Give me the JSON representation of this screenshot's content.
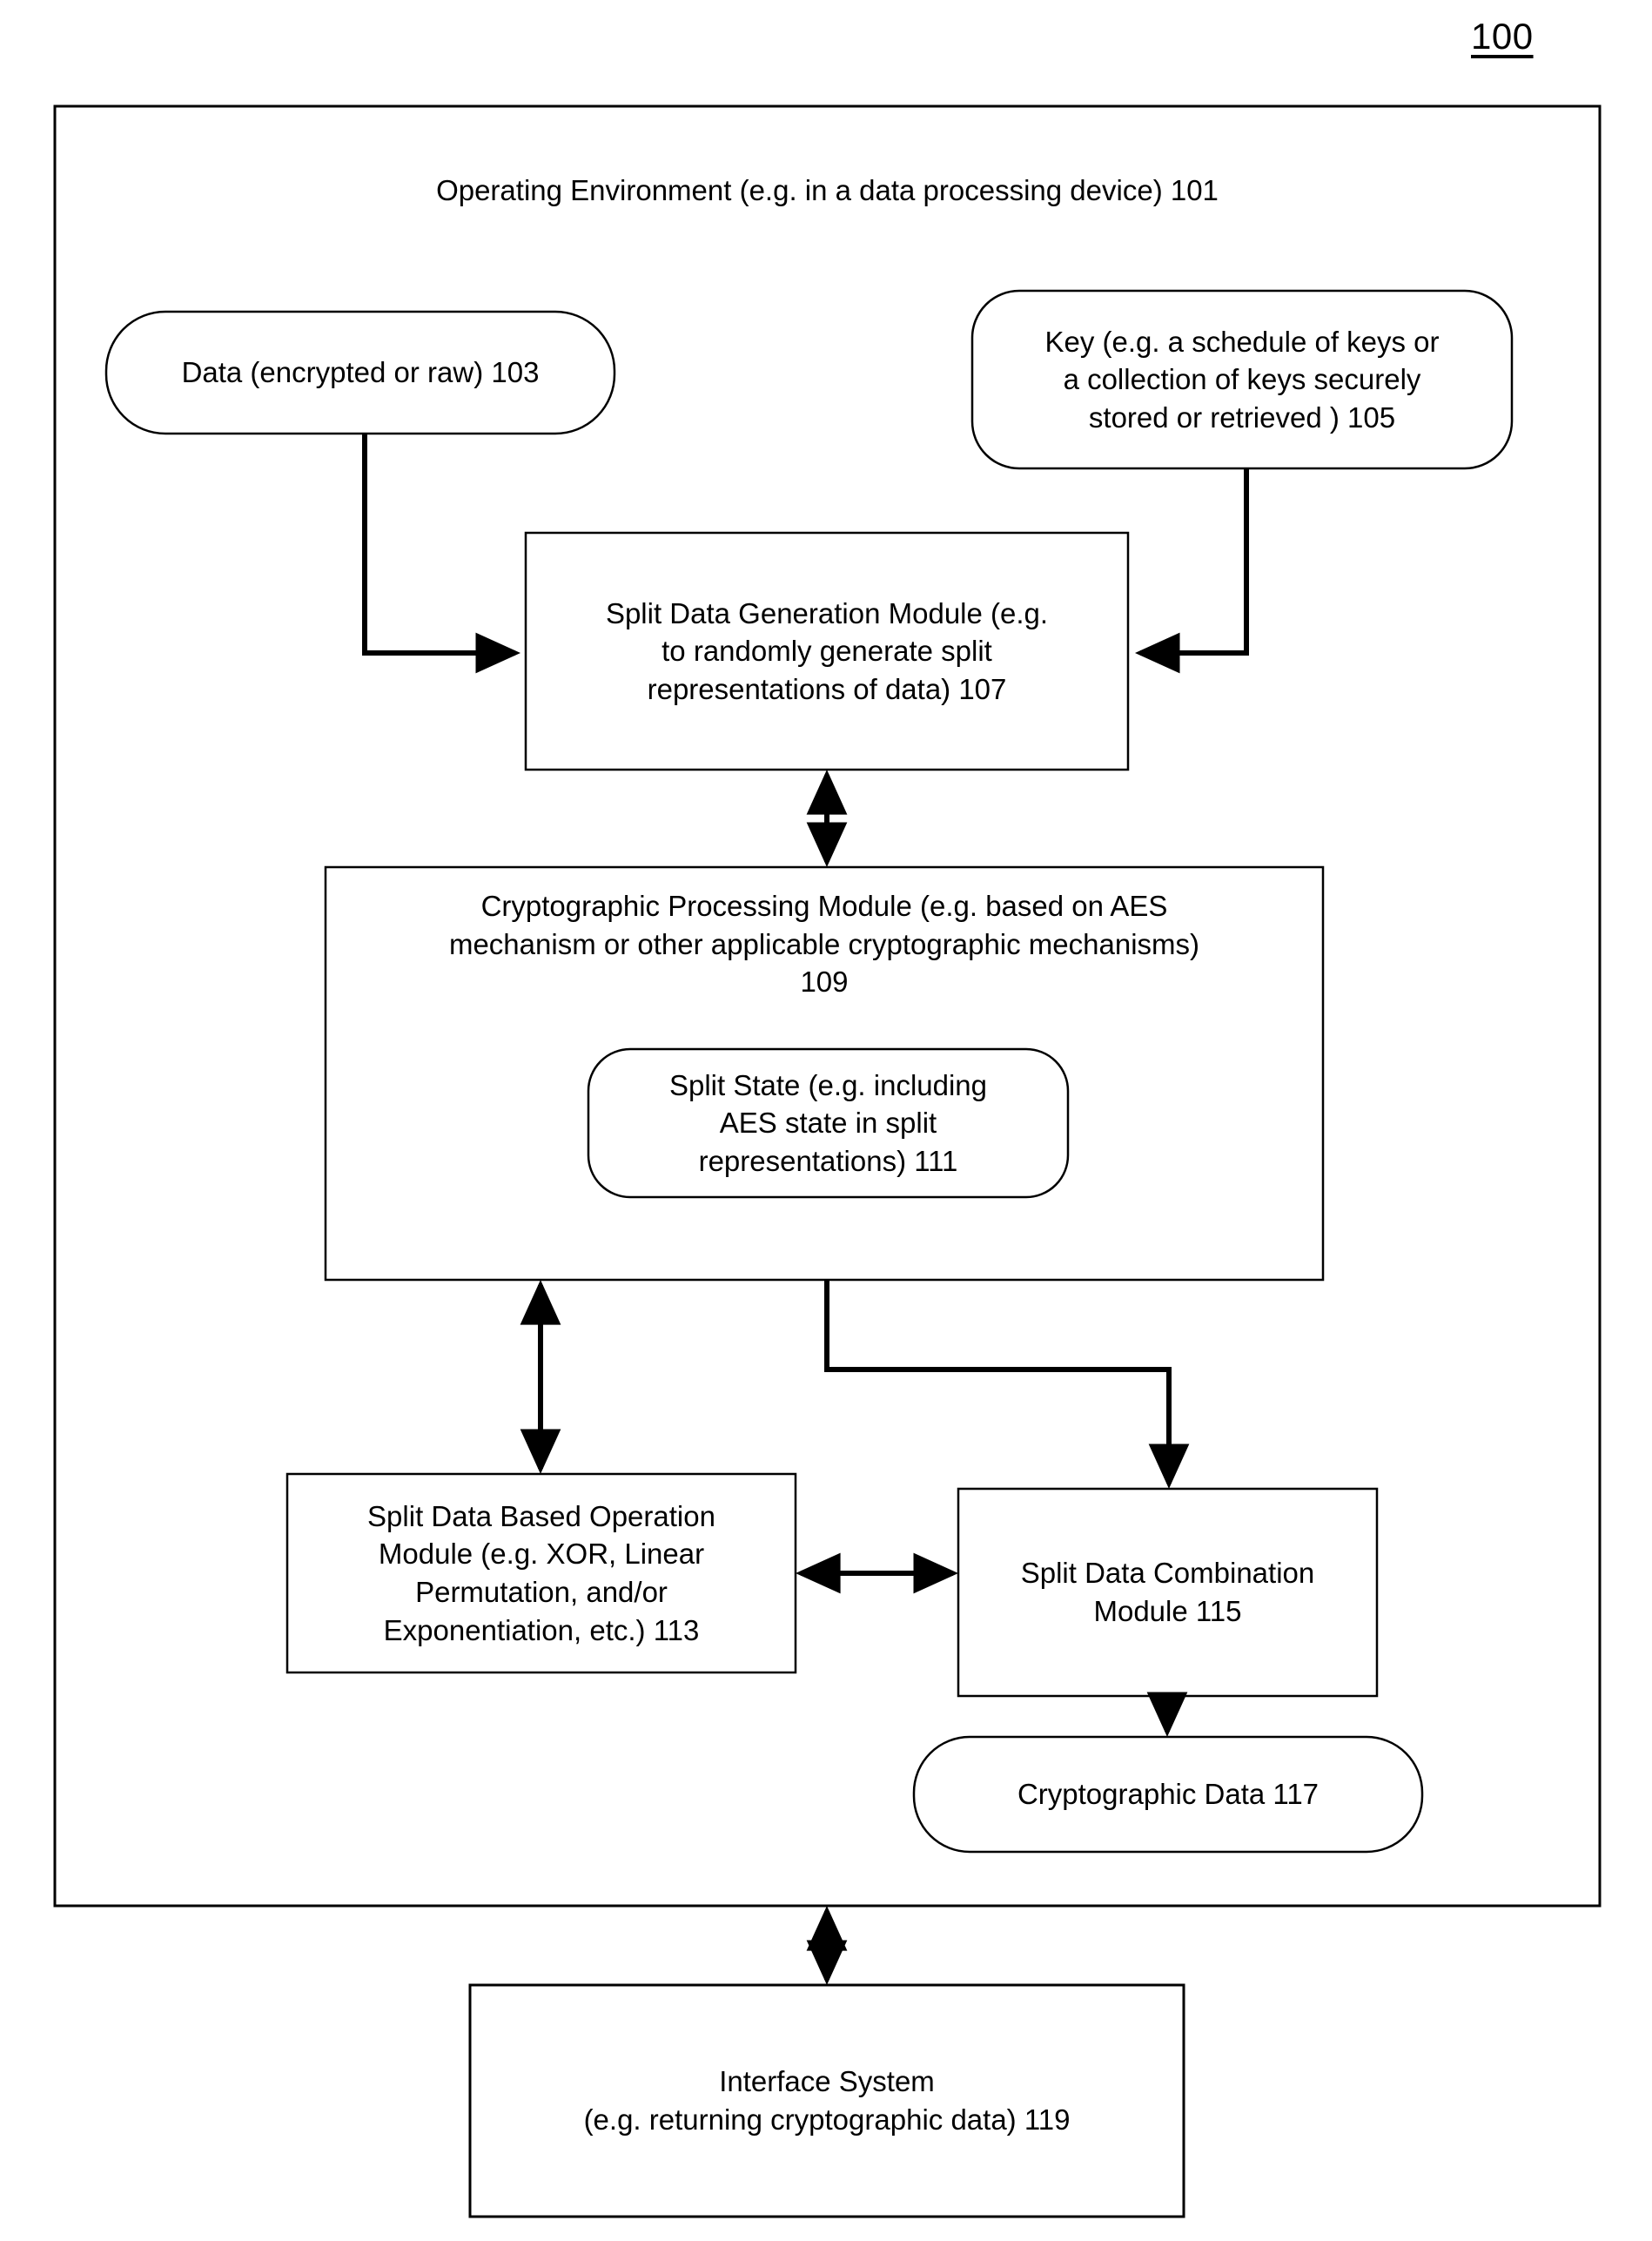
{
  "figure": {
    "number": "100"
  },
  "container": {
    "name": "operating-environment",
    "title": "Operating Environment (e.g. in a data processing device) 101"
  },
  "nodes": {
    "data": {
      "label": "Data (encrypted or raw) 103",
      "shape": "rounded"
    },
    "key": {
      "label": "Key (e.g. a schedule of keys or\na collection of keys securely\nstored or retrieved ) 105",
      "shape": "rounded"
    },
    "split_data_generation": {
      "label": "Split Data Generation Module (e.g.\nto randomly generate split\nrepresentations of data) 107",
      "shape": "rect"
    },
    "cryptographic_processing": {
      "label": "Cryptographic Processing Module (e.g. based on AES\nmechanism or other applicable cryptographic mechanisms)\n109",
      "shape": "rect"
    },
    "split_state": {
      "label": "Split State (e.g. including\nAES state in split\nrepresentations) 111",
      "shape": "rounded"
    },
    "split_data_based_operation": {
      "label": "Split Data Based Operation\nModule (e.g. XOR, Linear\nPermutation, and/or\nExponentiation, etc.) 113",
      "shape": "rect"
    },
    "split_data_combination": {
      "label": "Split Data Combination\nModule  115",
      "shape": "rect"
    },
    "cryptographic_data": {
      "label": "Cryptographic Data  117",
      "shape": "rounded"
    },
    "interface_system": {
      "label": "Interface System\n(e.g. returning cryptographic data) 119",
      "shape": "rect"
    }
  },
  "edges": [
    {
      "name": "data-to-split-data-generation",
      "from": "data",
      "to": "split_data_generation",
      "arrowheads": "single"
    },
    {
      "name": "key-to-split-data-generation",
      "from": "key",
      "to": "split_data_generation",
      "arrowheads": "single"
    },
    {
      "name": "split-data-generation-to-cryptographic-processing",
      "from": "split_data_generation",
      "to": "cryptographic_processing",
      "arrowheads": "double"
    },
    {
      "name": "cryptographic-processing-to-split-data-based-operation",
      "from": "cryptographic_processing",
      "to": "split_data_based_operation",
      "arrowheads": "double"
    },
    {
      "name": "cryptographic-processing-to-split-data-combination",
      "from": "cryptographic_processing",
      "to": "split_data_combination",
      "arrowheads": "single"
    },
    {
      "name": "split-data-based-operation-to-split-data-combination",
      "from": "split_data_based_operation",
      "to": "split_data_combination",
      "arrowheads": "double"
    },
    {
      "name": "split-data-combination-to-cryptographic-data",
      "from": "split_data_combination",
      "to": "cryptographic_data",
      "arrowheads": "single"
    },
    {
      "name": "operating-environment-to-interface-system",
      "from": "container",
      "to": "interface_system",
      "arrowheads": "double"
    }
  ],
  "style": {
    "stroke": "#000000",
    "fill": "#ffffff",
    "background": "#ffffff"
  }
}
